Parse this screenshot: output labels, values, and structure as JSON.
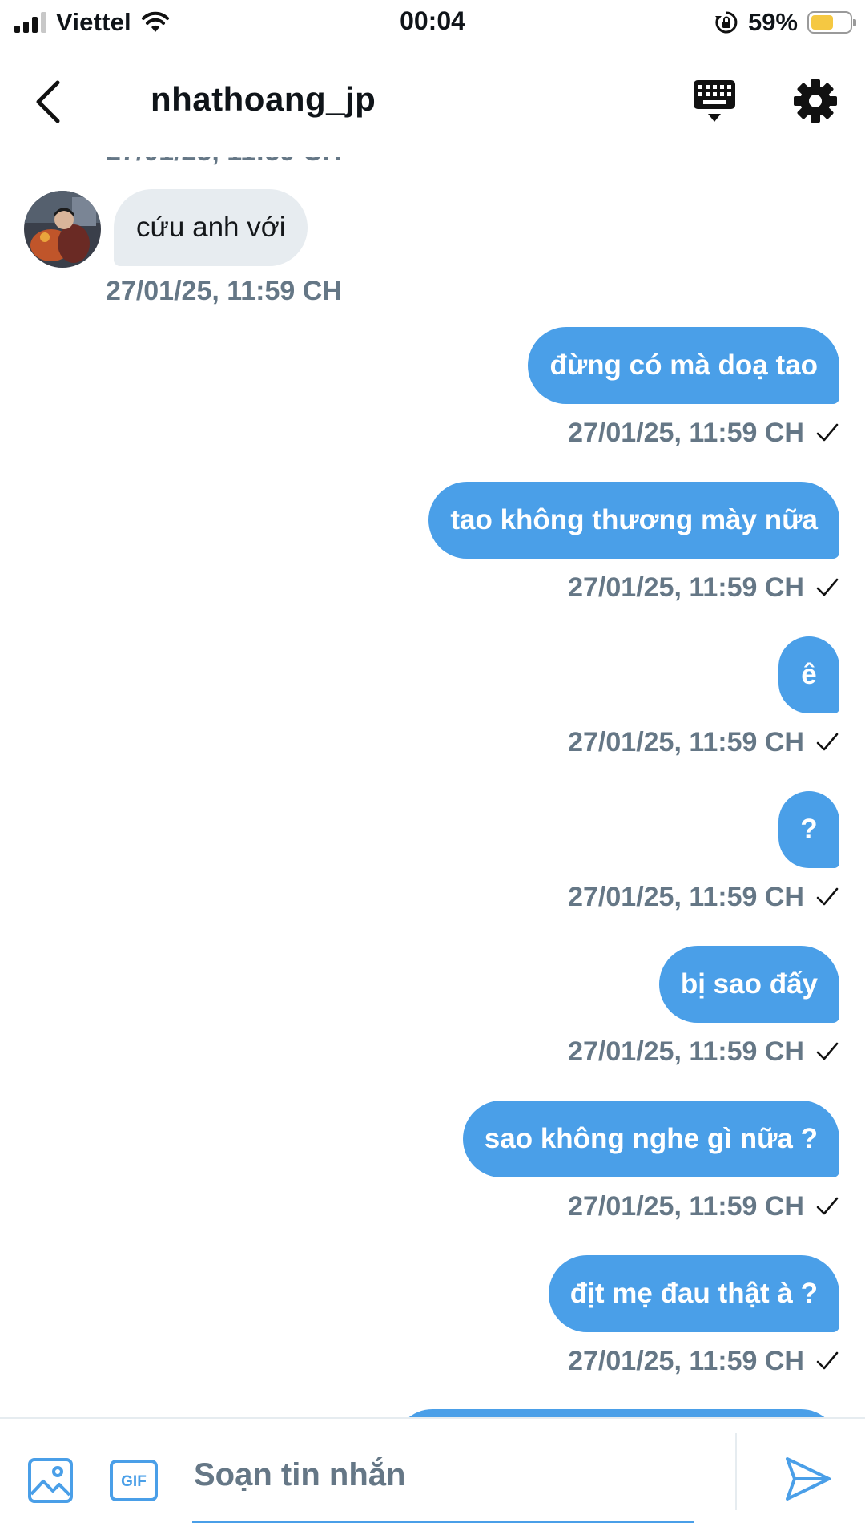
{
  "status_bar": {
    "carrier": "Viettel",
    "time": "00:04",
    "battery_percent_text": "59%",
    "battery_level": 0.59,
    "battery_color": "#f5c842"
  },
  "header": {
    "title": "nhathoang_jp",
    "icons": [
      "back-arrow-icon",
      "keyboard-icon",
      "gear-icon"
    ]
  },
  "conversation": {
    "clipped_timestamp": "27/01/25, 11:59 CH",
    "incoming": {
      "text": "cứu anh với",
      "timestamp": "27/01/25, 11:59 CH"
    },
    "outgoing": [
      {
        "text": "đừng có mà doạ tao",
        "timestamp": "27/01/25, 11:59 CH"
      },
      {
        "text": "tao không thương mày nữa",
        "timestamp": "27/01/25, 11:59 CH"
      },
      {
        "text": "ê",
        "timestamp": "27/01/25, 11:59 CH"
      },
      {
        "text": "?",
        "timestamp": "27/01/25, 11:59 CH"
      },
      {
        "text": "bị sao đấy",
        "timestamp": "27/01/25, 11:59 CH"
      },
      {
        "text": "sao không nghe gì nữa ?",
        "timestamp": "27/01/25, 11:59 CH"
      },
      {
        "text": "địt mẹ đau thật à ?",
        "timestamp": "27/01/25, 11:59 CH"
      }
    ]
  },
  "composer": {
    "placeholder": "Soạn tin nhắn",
    "gif_label": "GIF"
  },
  "colors": {
    "accent": "#4a9fe8",
    "incoming_bubble": "#e7ecf0",
    "timestamp": "#657786"
  }
}
